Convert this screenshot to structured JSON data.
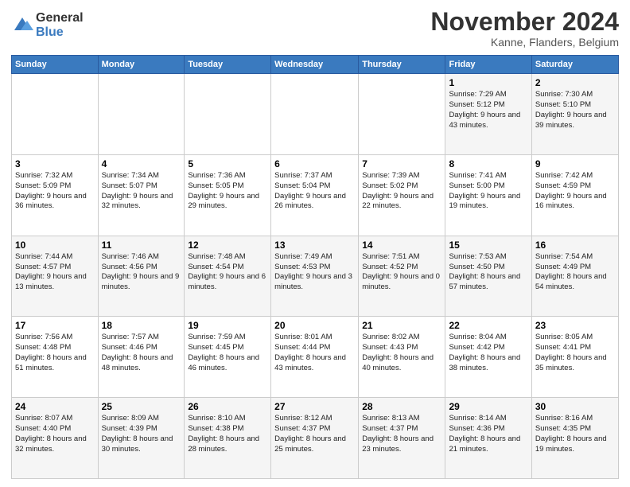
{
  "logo": {
    "line1": "General",
    "line2": "Blue"
  },
  "title": "November 2024",
  "location": "Kanne, Flanders, Belgium",
  "days_header": [
    "Sunday",
    "Monday",
    "Tuesday",
    "Wednesday",
    "Thursday",
    "Friday",
    "Saturday"
  ],
  "weeks": [
    [
      {
        "day": "",
        "info": ""
      },
      {
        "day": "",
        "info": ""
      },
      {
        "day": "",
        "info": ""
      },
      {
        "day": "",
        "info": ""
      },
      {
        "day": "",
        "info": ""
      },
      {
        "day": "1",
        "info": "Sunrise: 7:29 AM\nSunset: 5:12 PM\nDaylight: 9 hours and 43 minutes."
      },
      {
        "day": "2",
        "info": "Sunrise: 7:30 AM\nSunset: 5:10 PM\nDaylight: 9 hours and 39 minutes."
      }
    ],
    [
      {
        "day": "3",
        "info": "Sunrise: 7:32 AM\nSunset: 5:09 PM\nDaylight: 9 hours and 36 minutes."
      },
      {
        "day": "4",
        "info": "Sunrise: 7:34 AM\nSunset: 5:07 PM\nDaylight: 9 hours and 32 minutes."
      },
      {
        "day": "5",
        "info": "Sunrise: 7:36 AM\nSunset: 5:05 PM\nDaylight: 9 hours and 29 minutes."
      },
      {
        "day": "6",
        "info": "Sunrise: 7:37 AM\nSunset: 5:04 PM\nDaylight: 9 hours and 26 minutes."
      },
      {
        "day": "7",
        "info": "Sunrise: 7:39 AM\nSunset: 5:02 PM\nDaylight: 9 hours and 22 minutes."
      },
      {
        "day": "8",
        "info": "Sunrise: 7:41 AM\nSunset: 5:00 PM\nDaylight: 9 hours and 19 minutes."
      },
      {
        "day": "9",
        "info": "Sunrise: 7:42 AM\nSunset: 4:59 PM\nDaylight: 9 hours and 16 minutes."
      }
    ],
    [
      {
        "day": "10",
        "info": "Sunrise: 7:44 AM\nSunset: 4:57 PM\nDaylight: 9 hours and 13 minutes."
      },
      {
        "day": "11",
        "info": "Sunrise: 7:46 AM\nSunset: 4:56 PM\nDaylight: 9 hours and 9 minutes."
      },
      {
        "day": "12",
        "info": "Sunrise: 7:48 AM\nSunset: 4:54 PM\nDaylight: 9 hours and 6 minutes."
      },
      {
        "day": "13",
        "info": "Sunrise: 7:49 AM\nSunset: 4:53 PM\nDaylight: 9 hours and 3 minutes."
      },
      {
        "day": "14",
        "info": "Sunrise: 7:51 AM\nSunset: 4:52 PM\nDaylight: 9 hours and 0 minutes."
      },
      {
        "day": "15",
        "info": "Sunrise: 7:53 AM\nSunset: 4:50 PM\nDaylight: 8 hours and 57 minutes."
      },
      {
        "day": "16",
        "info": "Sunrise: 7:54 AM\nSunset: 4:49 PM\nDaylight: 8 hours and 54 minutes."
      }
    ],
    [
      {
        "day": "17",
        "info": "Sunrise: 7:56 AM\nSunset: 4:48 PM\nDaylight: 8 hours and 51 minutes."
      },
      {
        "day": "18",
        "info": "Sunrise: 7:57 AM\nSunset: 4:46 PM\nDaylight: 8 hours and 48 minutes."
      },
      {
        "day": "19",
        "info": "Sunrise: 7:59 AM\nSunset: 4:45 PM\nDaylight: 8 hours and 46 minutes."
      },
      {
        "day": "20",
        "info": "Sunrise: 8:01 AM\nSunset: 4:44 PM\nDaylight: 8 hours and 43 minutes."
      },
      {
        "day": "21",
        "info": "Sunrise: 8:02 AM\nSunset: 4:43 PM\nDaylight: 8 hours and 40 minutes."
      },
      {
        "day": "22",
        "info": "Sunrise: 8:04 AM\nSunset: 4:42 PM\nDaylight: 8 hours and 38 minutes."
      },
      {
        "day": "23",
        "info": "Sunrise: 8:05 AM\nSunset: 4:41 PM\nDaylight: 8 hours and 35 minutes."
      }
    ],
    [
      {
        "day": "24",
        "info": "Sunrise: 8:07 AM\nSunset: 4:40 PM\nDaylight: 8 hours and 32 minutes."
      },
      {
        "day": "25",
        "info": "Sunrise: 8:09 AM\nSunset: 4:39 PM\nDaylight: 8 hours and 30 minutes."
      },
      {
        "day": "26",
        "info": "Sunrise: 8:10 AM\nSunset: 4:38 PM\nDaylight: 8 hours and 28 minutes."
      },
      {
        "day": "27",
        "info": "Sunrise: 8:12 AM\nSunset: 4:37 PM\nDaylight: 8 hours and 25 minutes."
      },
      {
        "day": "28",
        "info": "Sunrise: 8:13 AM\nSunset: 4:37 PM\nDaylight: 8 hours and 23 minutes."
      },
      {
        "day": "29",
        "info": "Sunrise: 8:14 AM\nSunset: 4:36 PM\nDaylight: 8 hours and 21 minutes."
      },
      {
        "day": "30",
        "info": "Sunrise: 8:16 AM\nSunset: 4:35 PM\nDaylight: 8 hours and 19 minutes."
      }
    ]
  ]
}
